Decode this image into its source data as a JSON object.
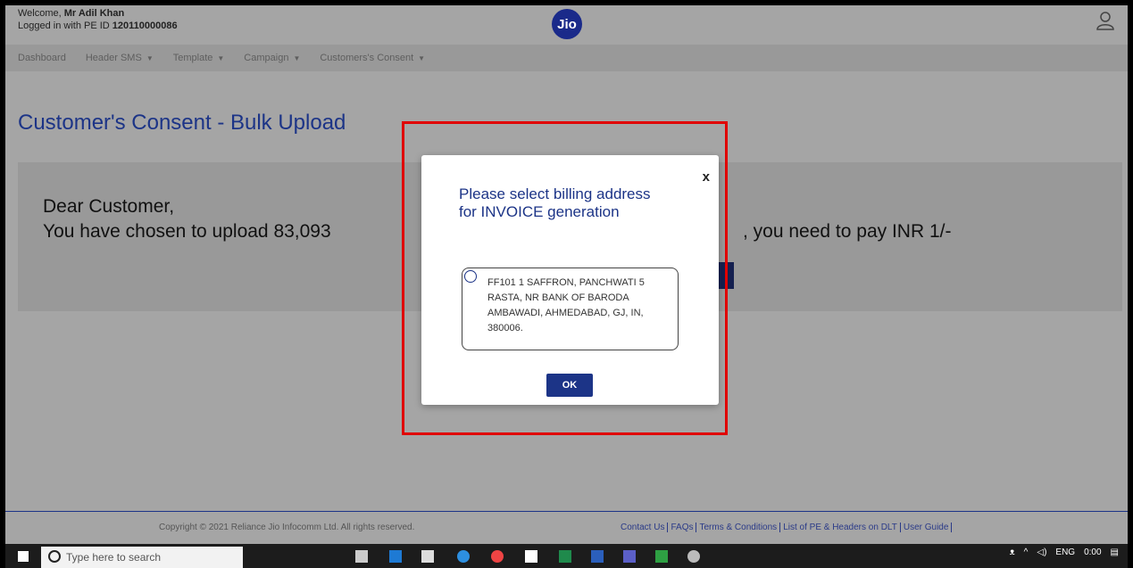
{
  "header": {
    "welcome_prefix": "Welcome,",
    "user_name": "Mr Adil Khan",
    "pe_prefix": "Logged in with PE ID",
    "pe_id": "120110000086",
    "logo_text": "Jio"
  },
  "nav": {
    "items": [
      {
        "label": "Dashboard",
        "has_caret": false
      },
      {
        "label": "Header SMS",
        "has_caret": true
      },
      {
        "label": "Template",
        "has_caret": true
      },
      {
        "label": "Campaign",
        "has_caret": true
      },
      {
        "label": "Customers's Consent",
        "has_caret": true
      }
    ]
  },
  "page": {
    "title": "Customer's Consent - Bulk Upload",
    "greeting": "Dear Customer,",
    "message_left": "You have chosen to upload 83,093",
    "message_right": ", you need to pay INR 1/-"
  },
  "modal": {
    "close_label": "x",
    "title": "Please select billing address for INVOICE generation",
    "address": "FF101 1 SAFFRON, PANCHWATI 5 RASTA, NR BANK OF BARODA AMBAWADI, AHMEDABAD, GJ, IN, 380006.",
    "ok_label": "OK"
  },
  "footer": {
    "copyright": "Copyright © 2021 Reliance Jio Infocomm Ltd. All rights reserved.",
    "links": [
      "Contact Us",
      "FAQs",
      "Terms & Conditions",
      "List of PE & Headers on DLT",
      "User Guide"
    ]
  },
  "taskbar": {
    "search_placeholder": "Type here to search",
    "language": "ENG",
    "time": "0:00"
  }
}
